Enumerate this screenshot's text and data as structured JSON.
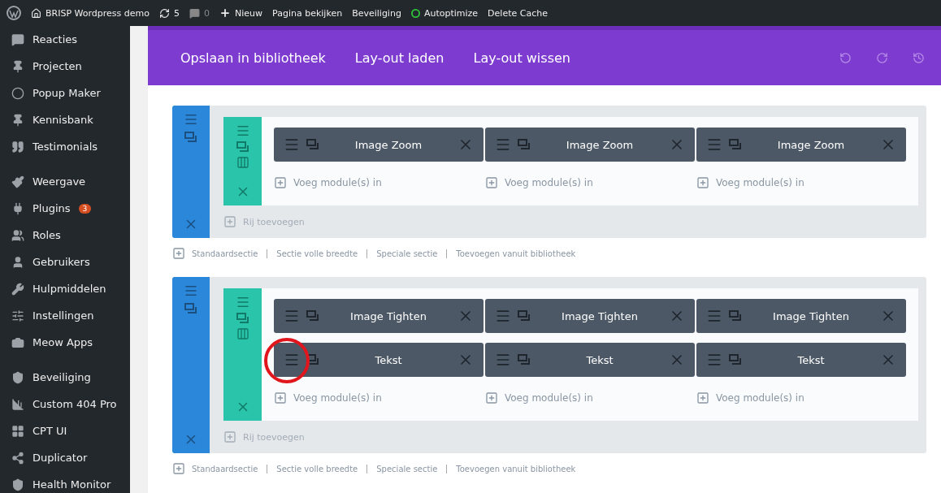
{
  "admin_bar": {
    "site": "BRISP Wordpress demo",
    "updates": "5",
    "comments": "0",
    "new": "Nieuw",
    "links": [
      "Pagina bekijken",
      "Beveiliging"
    ],
    "autoptimize": "Autoptimize",
    "delete_cache": "Delete Cache"
  },
  "sidebar": {
    "groups": [
      [
        {
          "label": "Reacties"
        },
        {
          "label": "Projecten"
        },
        {
          "label": "Popup Maker"
        },
        {
          "label": "Kennisbank"
        },
        {
          "label": "Testimonials"
        }
      ],
      [
        {
          "label": "Weergave"
        },
        {
          "label": "Plugins",
          "badge": "3"
        },
        {
          "label": "Roles"
        },
        {
          "label": "Gebruikers"
        },
        {
          "label": "Hulpmiddelen"
        },
        {
          "label": "Instellingen"
        },
        {
          "label": "Meow Apps"
        }
      ],
      [
        {
          "label": "Beveiliging"
        },
        {
          "label": "Custom 404 Pro"
        },
        {
          "label": "CPT UI"
        },
        {
          "label": "Duplicator"
        },
        {
          "label": "Health Monitor"
        }
      ]
    ]
  },
  "builder_toolbar": {
    "buttons": [
      "Opslaan in bibliotheek",
      "Lay-out laden",
      "Lay-out wissen"
    ]
  },
  "sections": [
    {
      "rows": [
        {
          "columns": [
            {
              "modules": [
                "Image Zoom"
              ],
              "add_label": "Voeg module(s) in"
            },
            {
              "modules": [
                "Image Zoom"
              ],
              "add_label": "Voeg module(s) in"
            },
            {
              "modules": [
                "Image Zoom"
              ],
              "add_label": "Voeg module(s) in"
            }
          ]
        }
      ],
      "add_row_label": "Rij toevoegen",
      "links": [
        "Standaardsectie",
        "Sectie volle breedte",
        "Speciale sectie",
        "Toevoegen vanuit bibliotheek"
      ]
    },
    {
      "rows": [
        {
          "columns": [
            {
              "modules": [
                "Image Tighten",
                "Tekst"
              ],
              "add_label": "Voeg module(s) in"
            },
            {
              "modules": [
                "Image Tighten",
                "Tekst"
              ],
              "add_label": "Voeg module(s) in"
            },
            {
              "modules": [
                "Image Tighten",
                "Tekst"
              ],
              "add_label": "Voeg module(s) in"
            }
          ]
        }
      ],
      "add_row_label": "Rij toevoegen",
      "links": [
        "Standaardsectie",
        "Sectie volle breedte",
        "Speciale sectie",
        "Toevoegen vanuit bibliotheek"
      ]
    }
  ]
}
